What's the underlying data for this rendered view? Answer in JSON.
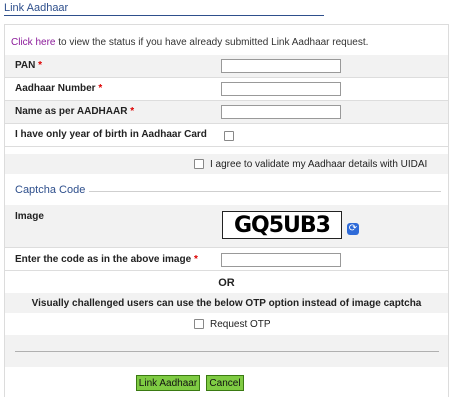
{
  "page": {
    "title": "Link Aadhaar",
    "notice_link": "Click here",
    "notice_text": " to view the status if you have already submitted Link Aadhaar request."
  },
  "form": {
    "pan_label": "PAN",
    "aadhaar_label": "Aadhaar Number",
    "name_label": "Name as per AADHAAR",
    "yob_label": "I have only year of birth in Aadhaar Card",
    "consent_label": "I agree to validate my Aadhaar details with UIDAI",
    "required_mark": "*"
  },
  "captcha": {
    "section_title": "Captcha Code",
    "image_label": "Image",
    "image_text": "GQ5UB3",
    "enter_label": "Enter the code as in the above image",
    "or_text": "OR",
    "otp_info": "Visually challenged users can use the below OTP option instead of image captcha",
    "otp_label": "Request OTP"
  },
  "buttons": {
    "submit": "Link Aadhaar",
    "cancel": "Cancel"
  },
  "colors": {
    "title": "#2e4f8c",
    "link": "#8b1a9a",
    "button": "#7fcb43",
    "required": "#dd0000"
  }
}
